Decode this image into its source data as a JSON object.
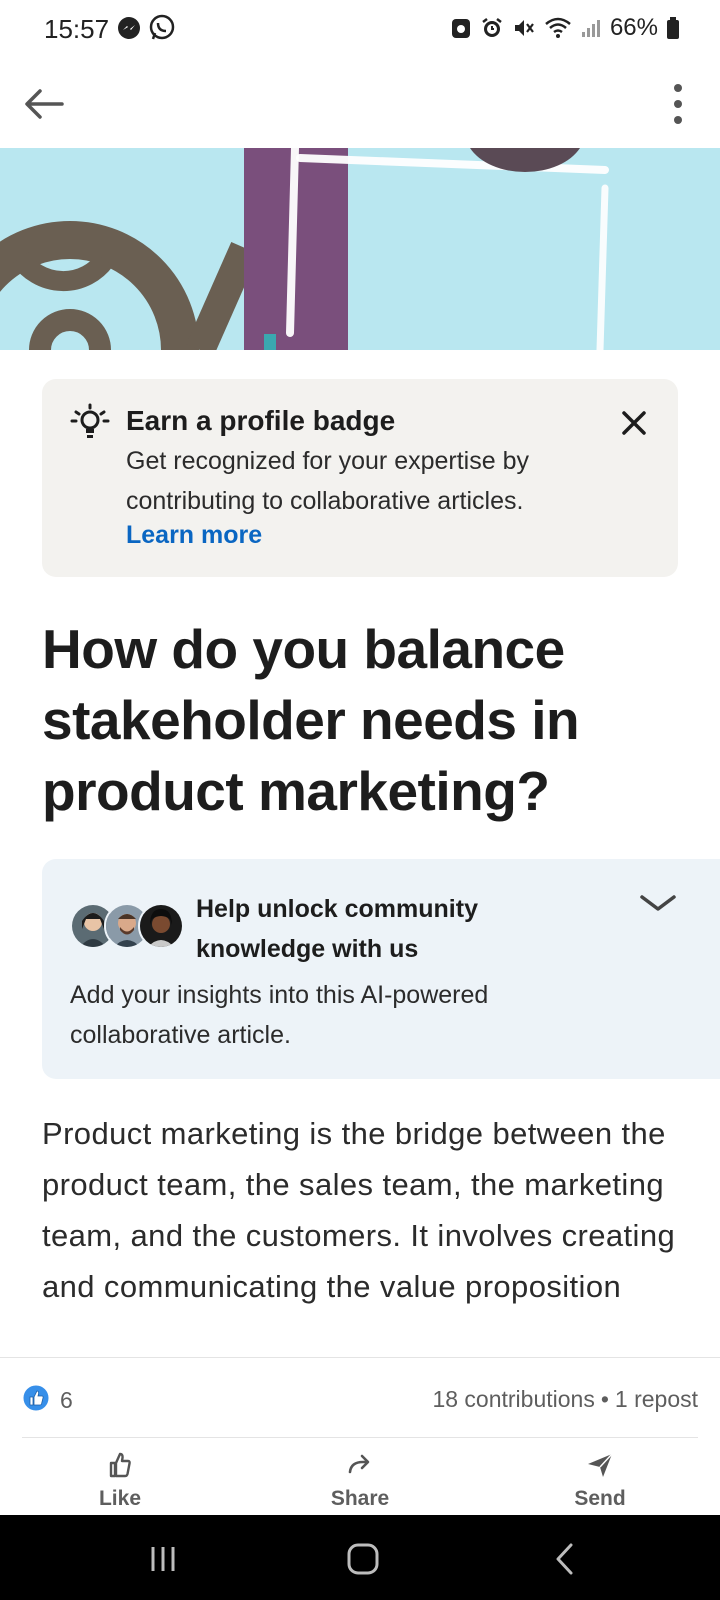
{
  "status_bar": {
    "time": "15:57",
    "left_icons": [
      "messenger-icon",
      "whatsapp-icon"
    ],
    "right_icons": [
      "app-icon",
      "alarm-icon",
      "mute-icon",
      "wifi-icon",
      "signal-icon",
      "battery-icon"
    ],
    "battery": "66%"
  },
  "top_bar": {
    "back_icon": "arrow-left-icon",
    "more_icon": "more-vertical-icon"
  },
  "badge_card": {
    "icon": "lightbulb-icon",
    "title": "Earn a profile badge",
    "body": "Get recognized for your expertise by contributing to collaborative articles.",
    "link": "Learn more",
    "close_icon": "close-icon"
  },
  "article": {
    "title": "How do you balance stakeholder needs in product marketing?",
    "body": "Product marketing is the bridge between the product team, the sales team, the marketing team, and the customers. It involves creating and communicating the value proposition"
  },
  "community": {
    "title": "Help unlock community knowledge with us",
    "body": "Add your insights into this AI-powered collaborative article.",
    "chevron_icon": "chevron-down-icon"
  },
  "engagement": {
    "reaction_count": "6",
    "contributions": "18 contributions",
    "separator": "•",
    "reposts": "1 repost"
  },
  "actions": [
    {
      "label": "Like",
      "icon": "thumbs-up-icon"
    },
    {
      "label": "Share",
      "icon": "share-arrow-icon"
    },
    {
      "label": "Send",
      "icon": "send-icon"
    }
  ],
  "colors": {
    "link_blue": "#0a66c2",
    "card_gray": "#f3f2ef",
    "card_blue": "#edf3f8",
    "hero_sky": "#b9e7f0"
  }
}
